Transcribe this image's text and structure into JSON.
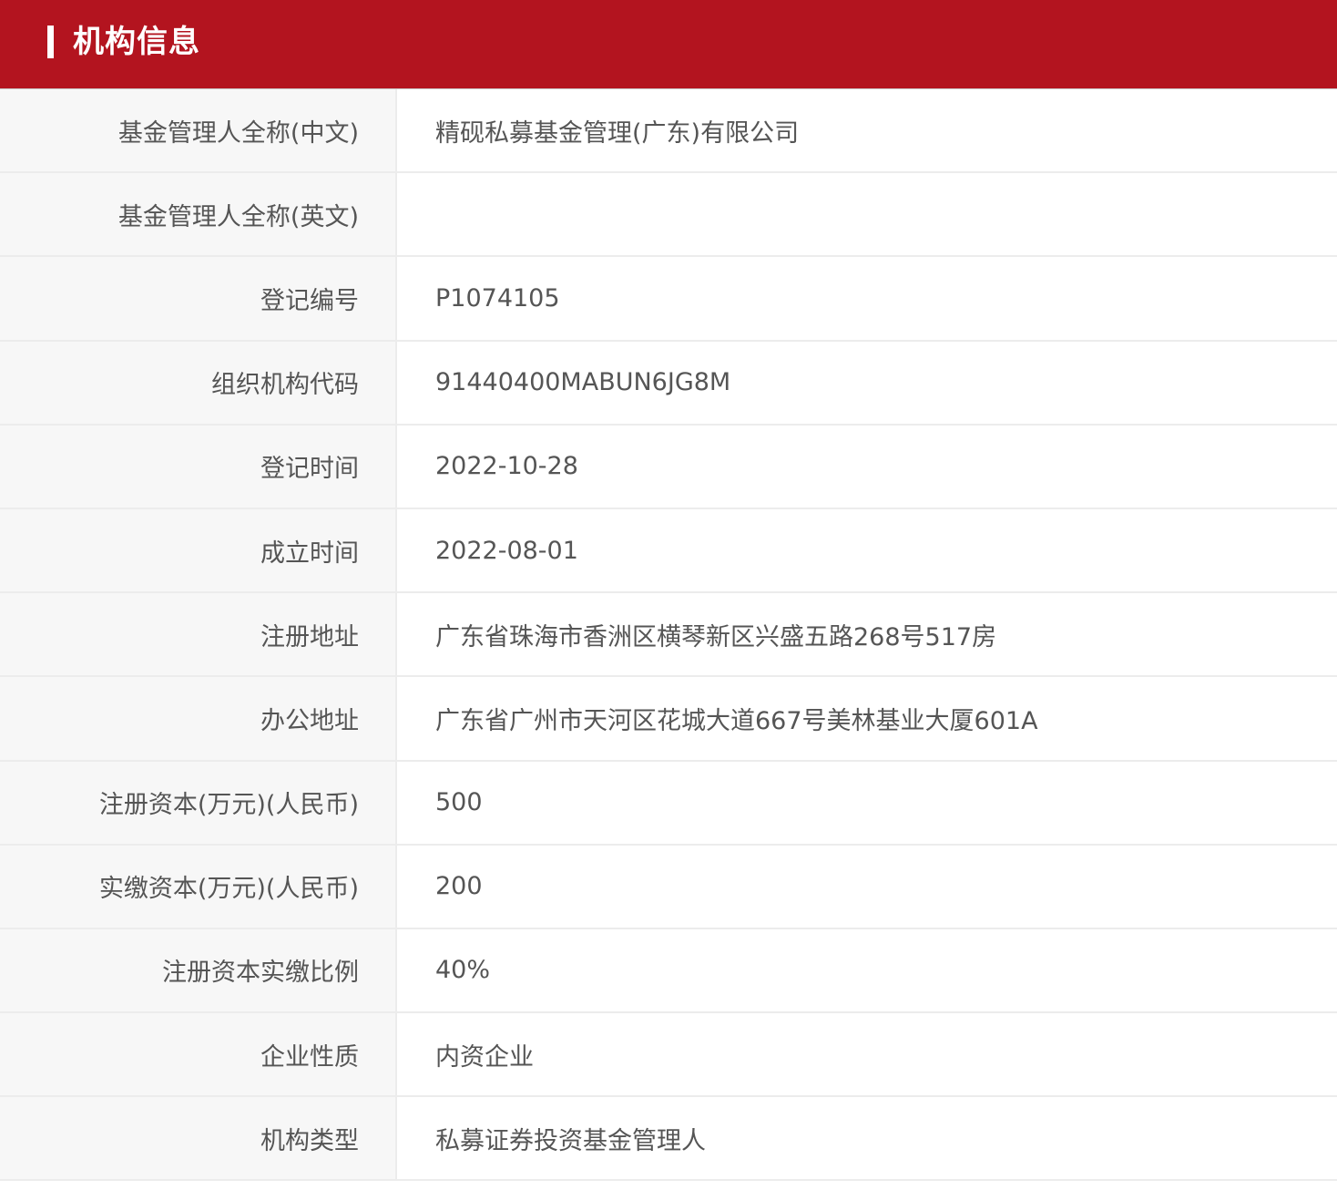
{
  "header": {
    "title": "机构信息"
  },
  "colors": {
    "header_background": "#b3141f",
    "label_background": "#f7f7f7",
    "text": "#555555",
    "divider": "#ececec"
  },
  "rows": [
    {
      "label": "基金管理人全称(中文)",
      "value": "精砚私募基金管理(广东)有限公司"
    },
    {
      "label": "基金管理人全称(英文)",
      "value": ""
    },
    {
      "label": "登记编号",
      "value": "P1074105"
    },
    {
      "label": "组织机构代码",
      "value": "91440400MABUN6JG8M"
    },
    {
      "label": "登记时间",
      "value": "2022-10-28"
    },
    {
      "label": "成立时间",
      "value": "2022-08-01"
    },
    {
      "label": "注册地址",
      "value": "广东省珠海市香洲区横琴新区兴盛五路268号517房"
    },
    {
      "label": "办公地址",
      "value": "广东省广州市天河区花城大道667号美林基业大厦601A"
    },
    {
      "label": "注册资本(万元)(人民币)",
      "value": "500"
    },
    {
      "label": "实缴资本(万元)(人民币)",
      "value": "200"
    },
    {
      "label": "注册资本实缴比例",
      "value": "40%"
    },
    {
      "label": "企业性质",
      "value": "内资企业"
    },
    {
      "label": "机构类型",
      "value": "私募证券投资基金管理人"
    }
  ]
}
